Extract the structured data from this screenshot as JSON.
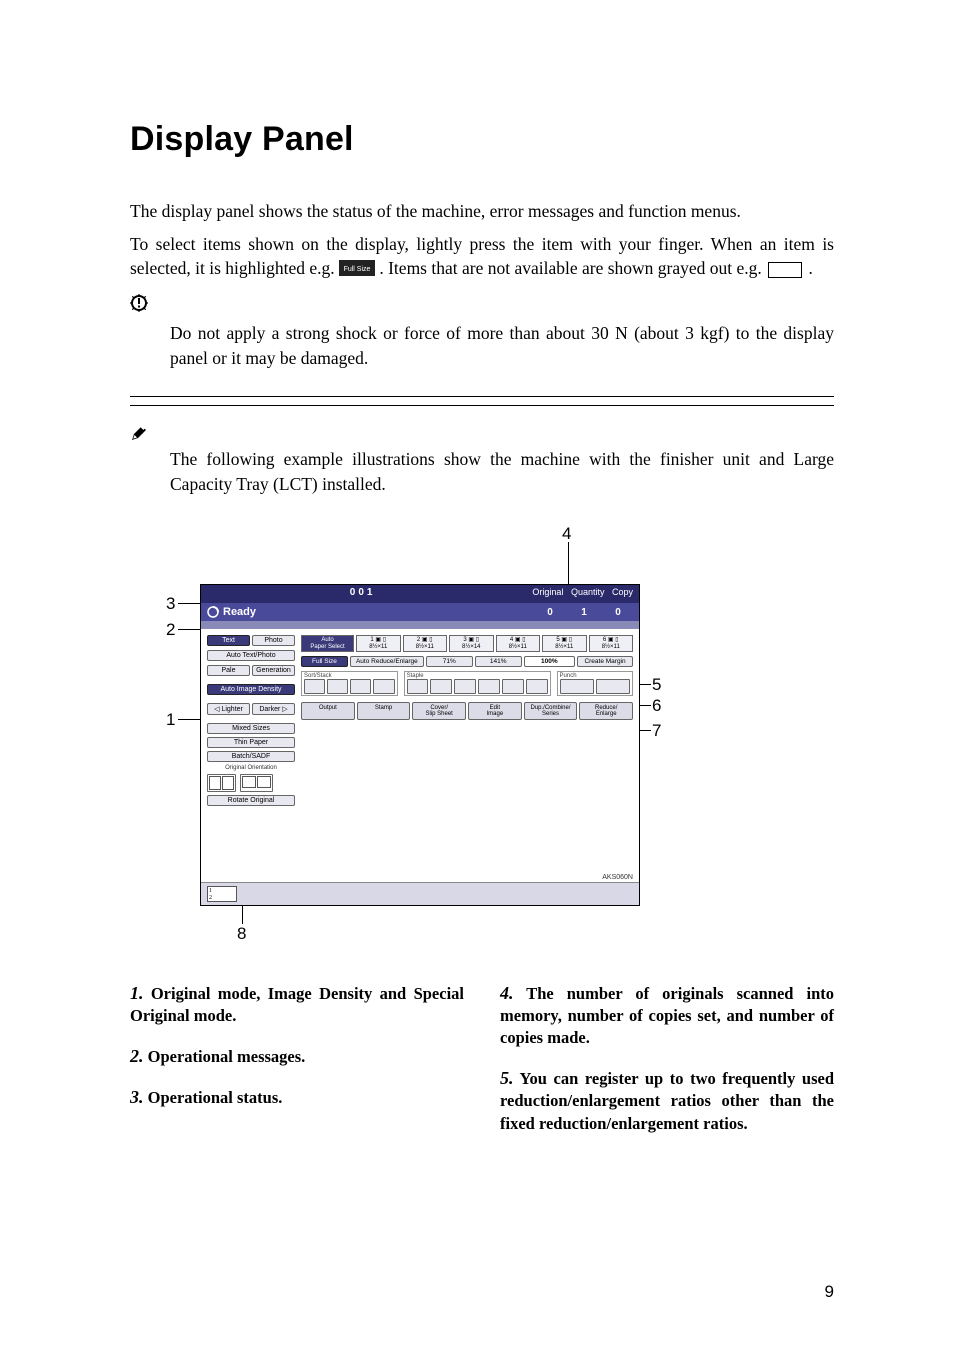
{
  "title": "Display Panel",
  "p1": "The display panel shows the status of the machine, error messages and function menus.",
  "p2a": "To select items shown on the display, lightly press the item with your finger. When an item is selected, it is highlighted e.g. ",
  "p2b": ". Items that are not available are shown grayed out e.g. ",
  "p2c": ".",
  "selected_icon_label": "Full Size",
  "important": "Do not apply a strong shock or force of more than about 30 N (about 3 kgf) to the display panel or it may be damaged.",
  "note": "The following example illustrations show the machine with the finisher unit and Large Capacity Tray (LCT) installed.",
  "callouts": {
    "c1": "1",
    "c2": "2",
    "c3": "3",
    "c4": "4",
    "c5": "5",
    "c6": "6",
    "c7": "7",
    "c8": "8"
  },
  "items": {
    "i1_num": "1.",
    "i1": " Original mode, Image Density and Special Original mode.",
    "i2_num": "2.",
    "i2": " Operational messages.",
    "i3_num": "3.",
    "i3": " Operational status.",
    "i4_num": "4.",
    "i4": " The number of originals scanned into memory, number of copies set, and number of copies made.",
    "i5_num": "5.",
    "i5": " You can register up to two frequently used reduction/enlargement ratios other than the fixed reduction/enlargement ratios."
  },
  "page_number": "9",
  "panel": {
    "title_number": "001",
    "ready": "Ready",
    "orig_lbl": "Original",
    "orig_val": "0",
    "qty_lbl": "Quantity",
    "qty_val": "1",
    "copy_lbl": "Copy",
    "copy_val": "0",
    "left": {
      "text": "Text",
      "photo": "Photo",
      "autotp": "Auto Text/Photo",
      "pale": "Pale",
      "gen": "Generation",
      "aid": "Auto Image Density",
      "lighter": "Lighter",
      "darker": "Darker",
      "mixed": "Mixed Sizes",
      "thin": "Thin Paper",
      "batch": "Batch/SADF",
      "oo": "Original Orientation",
      "rotate": "Rotate Original"
    },
    "trays": {
      "auto": "Auto\nPaper Select",
      "t1": "1 ▣ ▯\n8½×11",
      "t2": "2 ▣ ▯\n8½×11",
      "t3": "3 ▣ ▯\n8½×14",
      "t4": "4 ▣ ▯\n8½×11",
      "t5": "5 ▣ ▯\n8½×11",
      "t6": "6 ▣ ▯\n8½×11"
    },
    "row2": {
      "full": "Full Size",
      "are": "Auto Reduce/Enlarge",
      "p71": "71%",
      "p141": "141%",
      "p100": "100%",
      "cm": "Create Margin"
    },
    "groups": {
      "sort": "Sort/Stack",
      "staple": "Staple",
      "punch": "Punch"
    },
    "tabs": {
      "output": "Output",
      "stamp": "Stamp",
      "cover": "Cover/\nSlip Sheet",
      "edit": "Edit\nImage",
      "dup": "Dup./Combine/\nSeries",
      "reduce": "Reduce/\nEnlarge"
    },
    "figid": "AKS060N",
    "mini": "1\n2"
  }
}
